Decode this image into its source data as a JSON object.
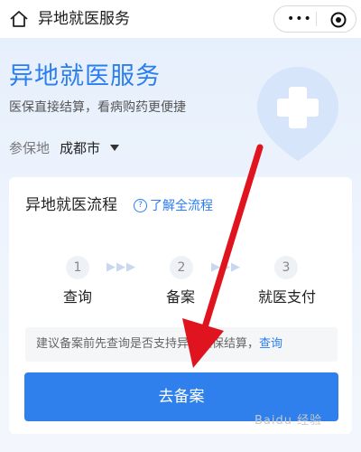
{
  "topbar": {
    "title": "异地就医服务",
    "more_glyph": "•••"
  },
  "hero": {
    "title": "异地就医服务",
    "subtitle": "医保直接结算，看病购药更便捷",
    "location_label": "参保地",
    "location_value": "成都市"
  },
  "card": {
    "title": "异地就医流程",
    "learn_link": "了解全流程",
    "help_glyph": "?",
    "arrow_glyph": "▶▶▶",
    "steps": [
      {
        "number": "1",
        "label": "查询"
      },
      {
        "number": "2",
        "label": "备案"
      },
      {
        "number": "3",
        "label": "就医支付"
      }
    ],
    "notice_text": "建议备案前先查询是否支持异地医保结算，",
    "notice_link": "查询",
    "button_label": "去备案"
  },
  "watermark": "Baidu 经验",
  "colors": {
    "accent": "#2f80ed",
    "title_blue": "#2a7ef0",
    "arrow_red": "#e0141e"
  },
  "icons": [
    "home-icon",
    "more-icon",
    "close-mini-icon",
    "caret-down-icon",
    "help-circle-icon",
    "red-pointer-arrow"
  ]
}
